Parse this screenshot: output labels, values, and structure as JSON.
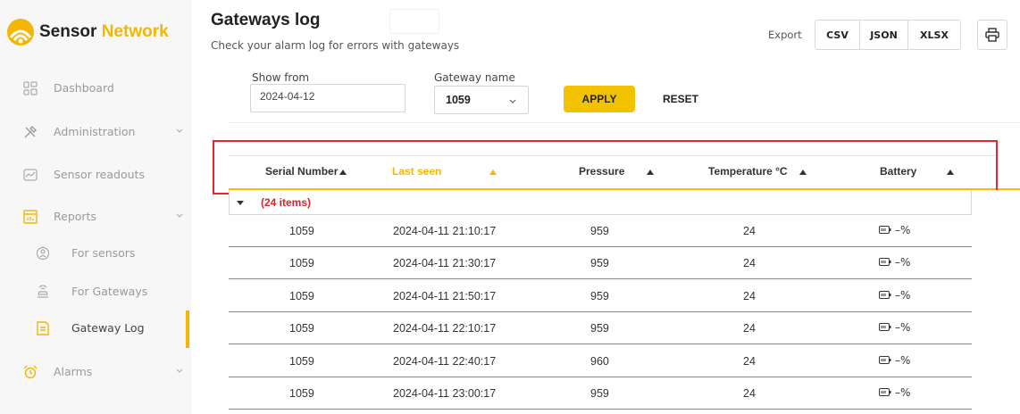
{
  "brand": {
    "part1": "Sensor ",
    "part2": "Network",
    "accent_color": "#f2b705"
  },
  "sidebar": {
    "items": [
      {
        "label": "Dashboard",
        "icon": "dashboard-icon"
      },
      {
        "label": "Administration",
        "icon": "tools-icon",
        "expandable": true
      },
      {
        "label": "Sensor readouts",
        "icon": "chart-icon"
      },
      {
        "label": "Reports",
        "icon": "reports-icon",
        "expandable": true
      },
      {
        "label": "For sensors",
        "icon": "sensor-icon",
        "sub": true
      },
      {
        "label": "For Gateways",
        "icon": "gateway-icon",
        "sub": true
      },
      {
        "label": "Gateway Log",
        "icon": "document-icon",
        "sub": true,
        "active": true
      },
      {
        "label": "Alarms",
        "icon": "alarm-clock-icon",
        "expandable": true
      }
    ]
  },
  "header": {
    "title": "Gateways log",
    "subtitle": "Check your alarm log for errors with gateways",
    "export_label": "Export",
    "export_buttons": [
      "CSV",
      "JSON",
      "XLSX"
    ]
  },
  "filters": {
    "show_from_label": "Show from",
    "show_from_value": "2024-04-12",
    "gateway_label": "Gateway name",
    "gateway_value": "1059",
    "apply_label": "APPLY",
    "reset_label": "RESET"
  },
  "table": {
    "columns": [
      "Serial Number",
      "Last seen",
      "Pressure",
      "Temperature °C",
      "Battery"
    ],
    "sorted_column": "Last seen",
    "group_label": "(24 items)",
    "rows": [
      {
        "serial": "1059",
        "last_seen": "2024-04-11 21:10:17",
        "pressure": "959",
        "temperature": "24",
        "battery": "–%"
      },
      {
        "serial": "1059",
        "last_seen": "2024-04-11 21:30:17",
        "pressure": "959",
        "temperature": "24",
        "battery": "–%"
      },
      {
        "serial": "1059",
        "last_seen": "2024-04-11 21:50:17",
        "pressure": "959",
        "temperature": "24",
        "battery": "–%"
      },
      {
        "serial": "1059",
        "last_seen": "2024-04-11 22:10:17",
        "pressure": "959",
        "temperature": "24",
        "battery": "–%"
      },
      {
        "serial": "1059",
        "last_seen": "2024-04-11 22:40:17",
        "pressure": "960",
        "temperature": "24",
        "battery": "–%"
      },
      {
        "serial": "1059",
        "last_seen": "2024-04-11 23:00:17",
        "pressure": "959",
        "temperature": "24",
        "battery": "–%"
      }
    ]
  },
  "colors": {
    "accent": "#f2c200",
    "highlight_box": "#e8262b",
    "group_count": "#e0202b"
  }
}
